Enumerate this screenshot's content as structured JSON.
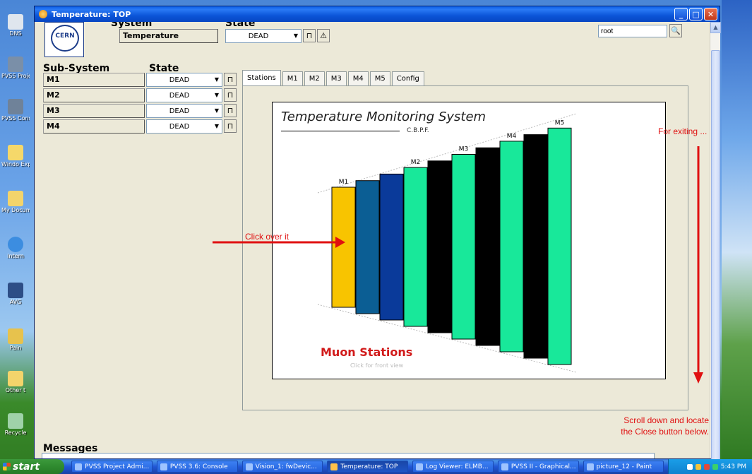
{
  "window": {
    "title": "Temperature: TOP"
  },
  "header": {
    "logo_text": "CERN",
    "system_label": "System",
    "state_label": "State",
    "system_name": "Temperature",
    "system_state": "DEAD",
    "user": "root"
  },
  "subsystems": {
    "label": "Sub-System",
    "state_label": "State",
    "items": [
      {
        "name": "M1",
        "state": "DEAD"
      },
      {
        "name": "M2",
        "state": "DEAD"
      },
      {
        "name": "M3",
        "state": "DEAD"
      },
      {
        "name": "M4",
        "state": "DEAD"
      }
    ]
  },
  "tabs": [
    "Stations",
    "M1",
    "M2",
    "M3",
    "M4",
    "M5",
    "Config"
  ],
  "panel": {
    "title": "Temperature Monitoring System",
    "subtitle": "C.B.P.F.",
    "footer": "Muon Stations",
    "footer_hint": "Click for front view",
    "stations": [
      {
        "label": "M1",
        "color": "#f8c400"
      },
      {
        "label": "",
        "color": "#0b5e94"
      },
      {
        "label": "",
        "color": "#0a3a9a"
      },
      {
        "label": "M2",
        "color": "#18e89a"
      },
      {
        "label": "",
        "color": "#000000"
      },
      {
        "label": "M3",
        "color": "#18e89a"
      },
      {
        "label": "",
        "color": "#000000"
      },
      {
        "label": "M4",
        "color": "#18e89a"
      },
      {
        "label": "",
        "color": "#000000"
      },
      {
        "label": "M5",
        "color": "#18e89a"
      }
    ]
  },
  "annotations": {
    "click": "Click over it",
    "exit": "For exiting ...",
    "scroll_line1": "Scroll down and locate",
    "scroll_line2": "the Close button below."
  },
  "messages_label": "Messages",
  "desktop_icons": [
    "DNS",
    "PVSS Project",
    "PVSS Cons",
    "Windo Explo",
    "My Docum",
    "Intern",
    "AVG",
    "Pain",
    "Other t",
    "Recycle"
  ],
  "taskbar": {
    "start": "start",
    "tasks": [
      "PVSS Project Admi...",
      "PVSS 3.6: Console",
      "Vision_1: fwDevic...",
      "Temperature: TOP",
      "Log Viewer: ELMB...",
      "PVSS II - Graphical...",
      "picture_12 - Paint"
    ],
    "active_task": "Temperature: TOP",
    "clock": "5:43 PM"
  }
}
